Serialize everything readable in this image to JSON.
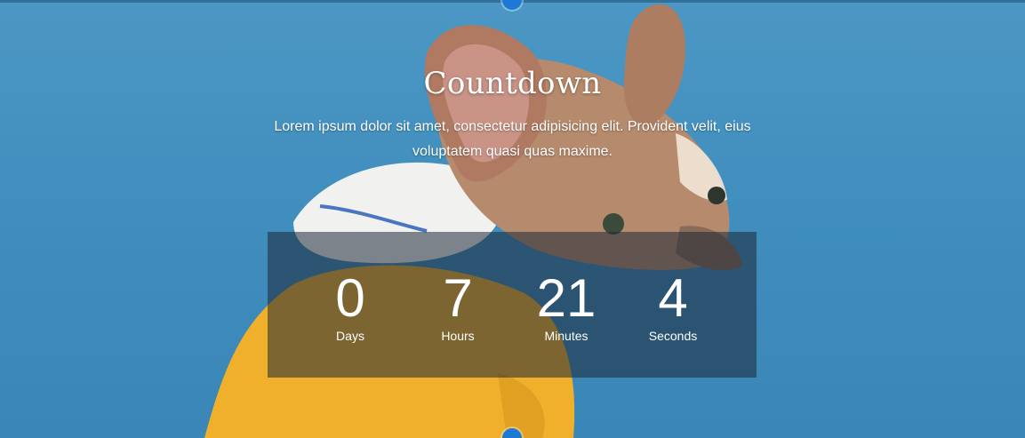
{
  "header": {
    "title": "Countdown",
    "description": "Lorem ipsum dolor sit amet, consectetur adipisicing elit. Provident velit, eius voluptatem quasi quas maxime."
  },
  "countdown": {
    "units": [
      {
        "value": "0",
        "label": "Days"
      },
      {
        "value": "7",
        "label": "Hours"
      },
      {
        "value": "21",
        "label": "Minutes"
      },
      {
        "value": "4",
        "label": "Seconds"
      }
    ]
  },
  "colors": {
    "background": "#4c97c4",
    "overlay": "#1e2837",
    "handle": "#1c79d6",
    "text": "#ffffff",
    "sweater": "#f0b02c"
  },
  "icons": {
    "top_handle": "plus-handle-icon",
    "bottom_handle": "plus-handle-icon"
  }
}
